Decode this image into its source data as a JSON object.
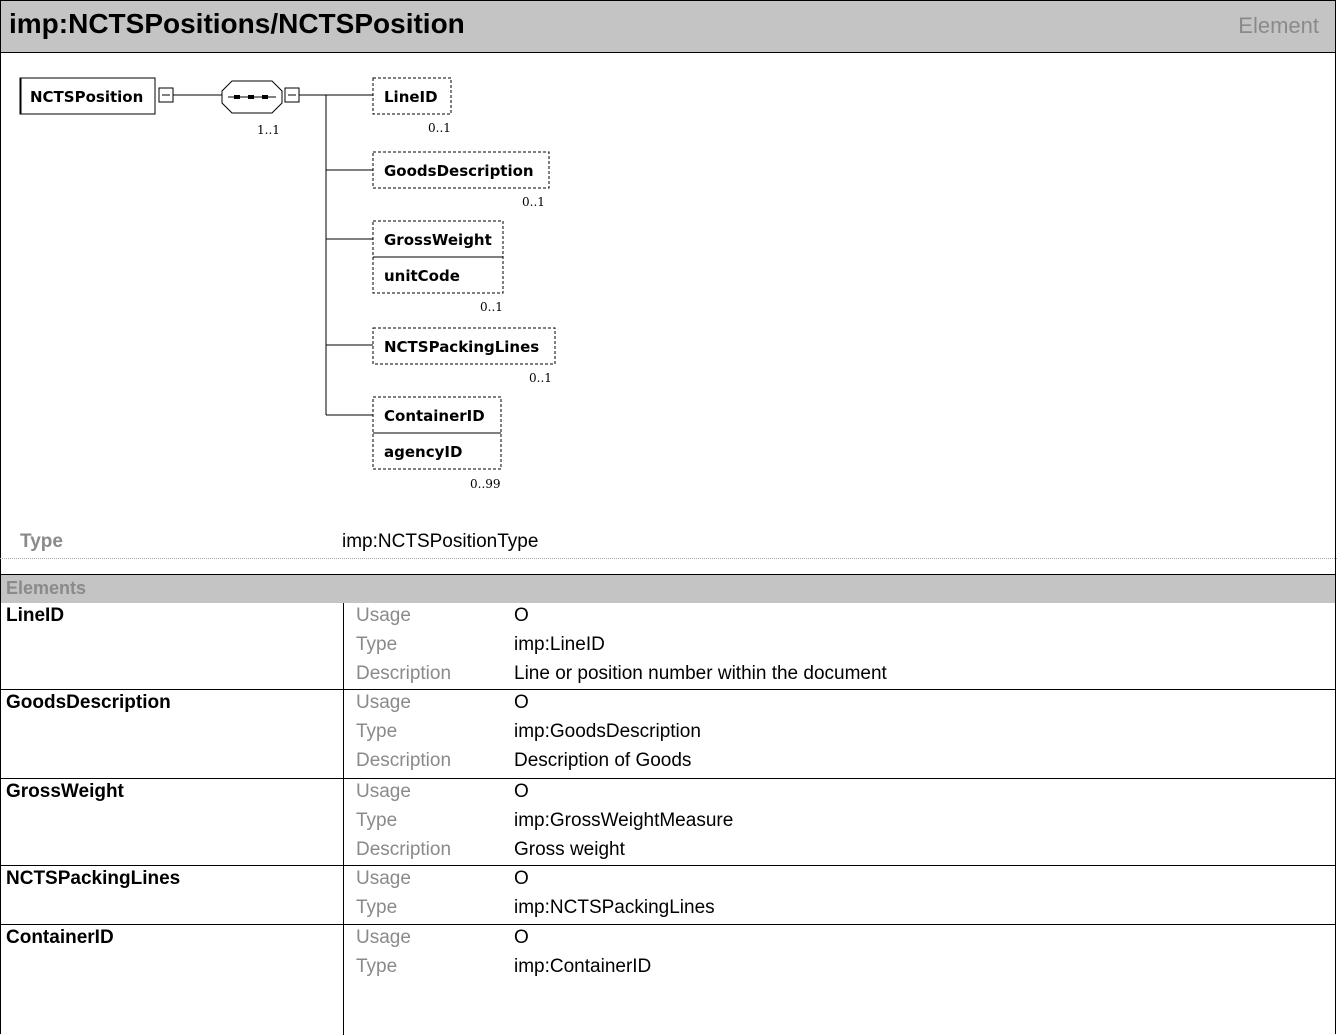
{
  "header": {
    "title": "imp:NCTSPositions/NCTSPosition",
    "kind": "Element"
  },
  "diagram": {
    "root": "NCTSPosition",
    "sequence_occurrence": "1..1",
    "children": [
      {
        "name": "LineID",
        "occurrence": "0..1"
      },
      {
        "name": "GoodsDescription",
        "occurrence": "0..1"
      },
      {
        "name": "GrossWeight",
        "attribute": "unitCode",
        "occurrence": "0..1"
      },
      {
        "name": "NCTSPackingLines",
        "occurrence": "0..1"
      },
      {
        "name": "ContainerID",
        "attribute": "agencyID",
        "occurrence": "0..99"
      }
    ]
  },
  "type_row": {
    "label": "Type",
    "value": "imp:NCTSPositionType"
  },
  "elements": {
    "header": "Elements",
    "labels": {
      "usage": "Usage",
      "type": "Type",
      "description": "Description"
    },
    "rows": [
      {
        "name": "LineID",
        "usage": "O",
        "type": "imp:LineID",
        "description": "Line or position number within the document"
      },
      {
        "name": "GoodsDescription",
        "usage": "O",
        "type": "imp:GoodsDescription",
        "description": "Description of Goods"
      },
      {
        "name": "GrossWeight",
        "usage": "O",
        "type": "imp:GrossWeightMeasure",
        "description": "Gross weight"
      },
      {
        "name": "NCTSPackingLines",
        "usage": "O",
        "type": "imp:NCTSPackingLines"
      },
      {
        "name": "ContainerID",
        "usage": "O",
        "type": "imp:ContainerID"
      }
    ]
  }
}
